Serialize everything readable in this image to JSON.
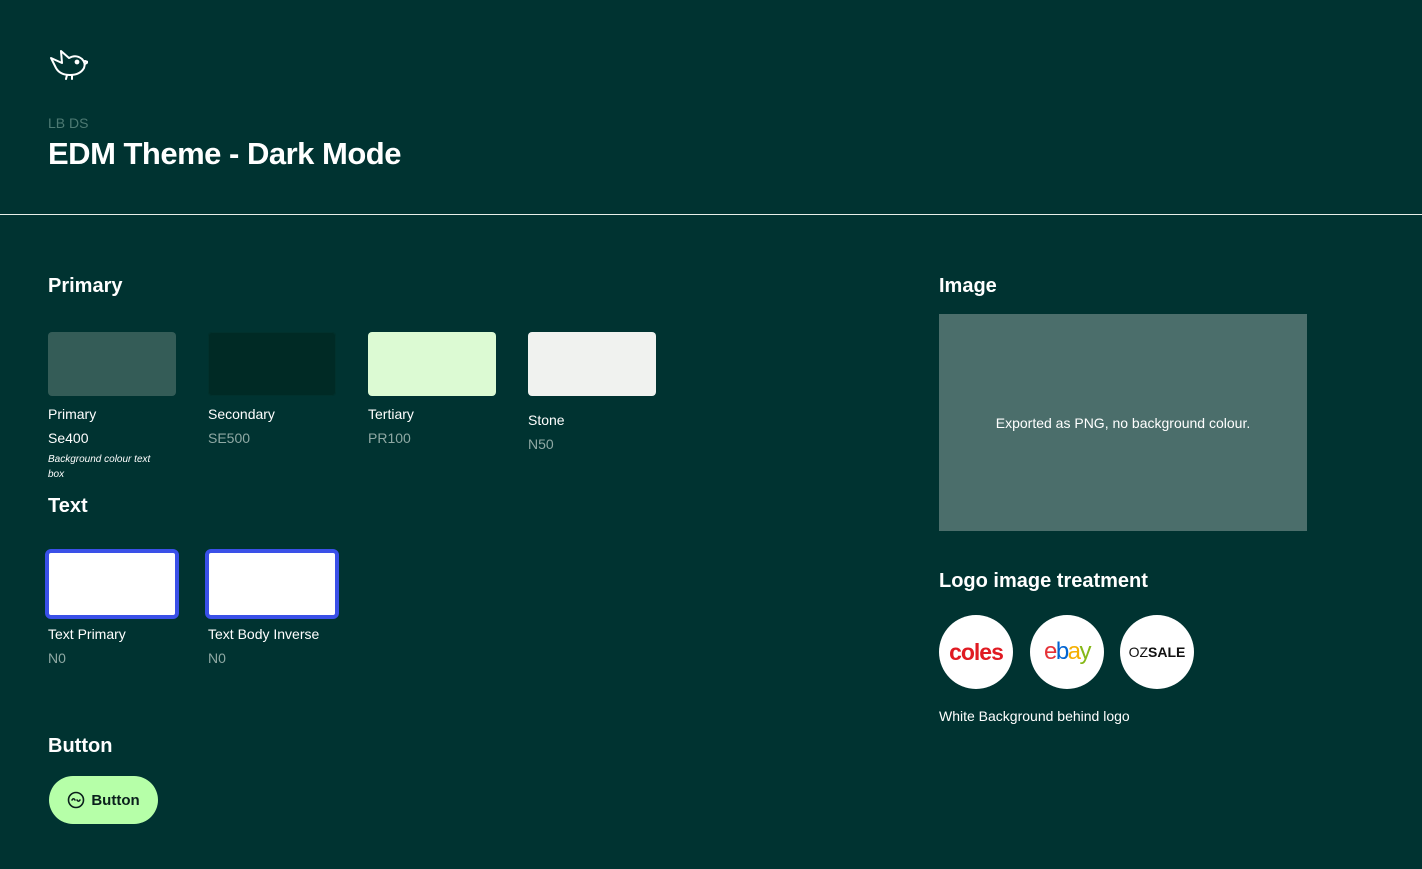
{
  "header": {
    "logo_icon": "bird-icon",
    "eyebrow": "LB DS",
    "title": "EDM Theme - Dark Mode"
  },
  "primary": {
    "title": "Primary",
    "swatches": [
      {
        "label": "Primary",
        "code": "Se400",
        "note": "Background colour text box",
        "color": "#345c57"
      },
      {
        "label": "Secondary",
        "code": "SE500",
        "color": "#002a25"
      },
      {
        "label": "Tertiary",
        "code": "PR100",
        "color": "#dcfad3"
      },
      {
        "label": "Stone",
        "code": "N50",
        "color": "#f0f2ef"
      }
    ]
  },
  "text": {
    "title": "Text",
    "swatches": [
      {
        "label": "Text Primary",
        "code": "N0",
        "color": "#ffffff"
      },
      {
        "label": "Text Body Inverse",
        "code": "N0",
        "color": "#ffffff"
      }
    ]
  },
  "button": {
    "title": "Button",
    "label": "Button",
    "icon": "smile-circle-icon",
    "color": "#b6ffa8"
  },
  "image": {
    "title": "Image",
    "caption": "Exported as PNG, no background colour."
  },
  "logo_treatment": {
    "title": "Logo image treatment",
    "logos": [
      "coles",
      "ebay",
      "OZSALE"
    ],
    "caption": "White Background behind logo"
  }
}
